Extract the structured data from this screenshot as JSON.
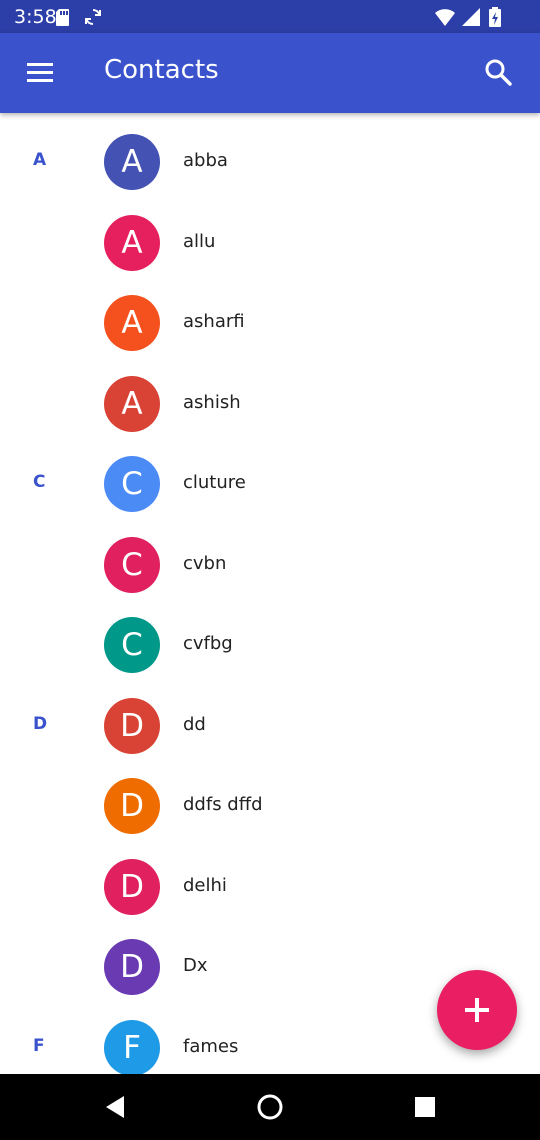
{
  "status_bar": {
    "time": "3:58",
    "icons": [
      "sd-card-icon",
      "sync-icon",
      "wifi-icon",
      "signal-icon",
      "battery-icon"
    ]
  },
  "app_bar": {
    "title": "Contacts",
    "menu_icon": "hamburger-menu-icon",
    "search_icon": "search-icon"
  },
  "contacts": [
    {
      "section": "A",
      "initial": "A",
      "name": "abba",
      "color": "#4352b3"
    },
    {
      "section": "",
      "initial": "A",
      "name": "allu",
      "color": "#e6205f"
    },
    {
      "section": "",
      "initial": "A",
      "name": "asharfi",
      "color": "#f4511e"
    },
    {
      "section": "",
      "initial": "A",
      "name": "ashish",
      "color": "#d84335"
    },
    {
      "section": "C",
      "initial": "C",
      "name": "cluture",
      "color": "#4a8bf5"
    },
    {
      "section": "",
      "initial": "C",
      "name": "cvbn",
      "color": "#e0205f"
    },
    {
      "section": "",
      "initial": "C",
      "name": "cvfbg",
      "color": "#009888"
    },
    {
      "section": "D",
      "initial": "D",
      "name": "dd",
      "color": "#d84335"
    },
    {
      "section": "",
      "initial": "D",
      "name": "ddfs dffd",
      "color": "#ef6c00"
    },
    {
      "section": "",
      "initial": "D",
      "name": "delhi",
      "color": "#e0205f"
    },
    {
      "section": "",
      "initial": "D",
      "name": "Dx",
      "color": "#6a3ab2"
    },
    {
      "section": "F",
      "initial": "F",
      "name": "fames",
      "color": "#1e9ae6"
    }
  ],
  "fab": {
    "icon": "plus-icon",
    "color": "#ea1e63"
  },
  "nav_bar": {
    "icons": [
      "back-icon",
      "home-icon",
      "recents-icon"
    ]
  },
  "colors": {
    "status_bar": "#2c3ea7",
    "app_bar": "#3a53cd",
    "section_letter": "#3a53cd"
  }
}
